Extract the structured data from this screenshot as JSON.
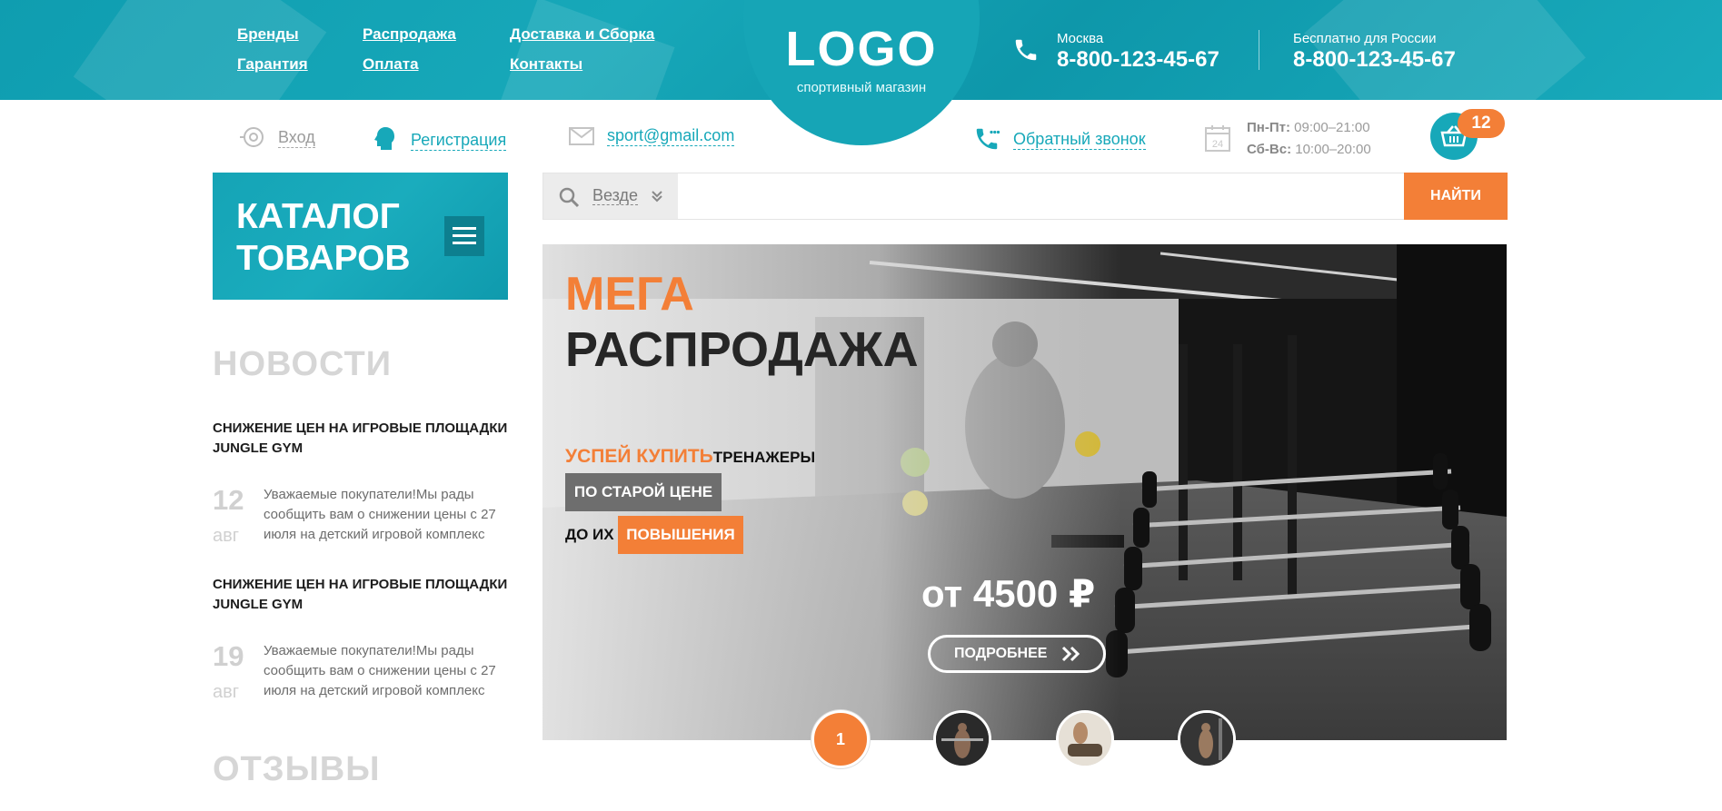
{
  "nav": {
    "col1": [
      "Бренды",
      "Гарантия"
    ],
    "col2": [
      "Распродажа",
      "Оплата"
    ],
    "col3": [
      "Доставка и Сборка",
      "Контакты"
    ]
  },
  "logo": {
    "title": "LOGO",
    "subtitle": "спортивный магазин"
  },
  "phones": [
    {
      "city": "Москва",
      "number": "8-800-123-45-67"
    },
    {
      "city": "Бесплатно для России",
      "number": "8-800-123-45-67"
    }
  ],
  "subbar": {
    "login": "Вход",
    "register": "Регистрация",
    "email": "sport@gmail.com",
    "callback": "Обратный звонок",
    "hours_weekday_label": "Пн-Пт:",
    "hours_weekday": "09:00–21:00",
    "hours_weekend_label": "Сб-Вс:",
    "hours_weekend": "10:00–20:00",
    "calendar_day": "24",
    "cart_count": "12"
  },
  "catalog": {
    "line1": "КАТАЛОГ",
    "line2": "ТОВАРОВ"
  },
  "news": {
    "heading": "НОВОСТИ",
    "items": [
      {
        "title": "Снижение цен на игровые площадки Jungle Gym",
        "day": "12",
        "month": "авг",
        "text": "Уважаемые покупатели!Мы рады сообщить вам о снижении цены с 27 июля на детский игровой комплекс"
      },
      {
        "title": "Снижение цен на игровые площадки Jungle Gym",
        "day": "19",
        "month": "авг",
        "text": "Уважаемые покупатели!Мы рады сообщить вам о снижении цены с 27 июля на детский игровой комплекс"
      }
    ]
  },
  "reviews": {
    "heading": "ОТЗЫВЫ"
  },
  "search": {
    "scope": "Везде",
    "placeholder": "",
    "button": "НАЙТИ"
  },
  "banner": {
    "mega": "МЕГА",
    "sale": "РАСПРОДАЖА",
    "hurry": "УСПЕЙ КУПИТЬ",
    "equipment": "ТРЕНАЖЕРЫ",
    "old_price": "ПО СТАРОЙ ЦЕНЕ",
    "until": "ДО ИХ",
    "increase": "ПОВЫШЕНИЯ",
    "price": "от 4500 ₽",
    "more": "ПОДРОБНЕЕ"
  },
  "slider": {
    "active": "1"
  },
  "colors": {
    "teal": "#17a8b9",
    "orange": "#f37f37",
    "grey_text": "#9b9b9b"
  }
}
